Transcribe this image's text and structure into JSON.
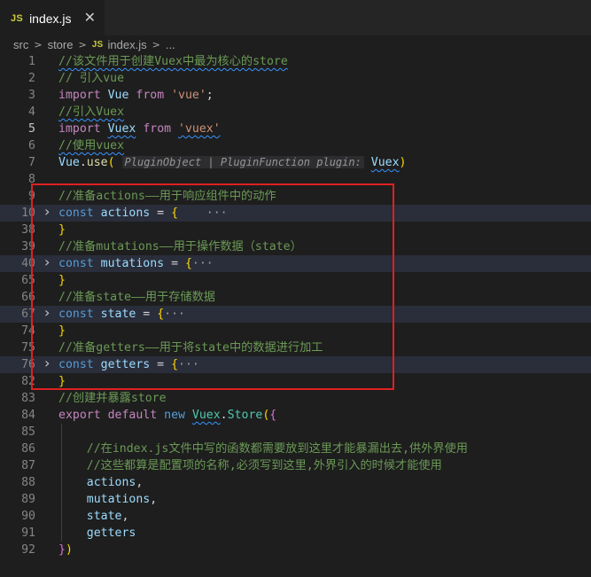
{
  "tab": {
    "badge": "JS",
    "filename": "index.js",
    "close": "✕"
  },
  "breadcrumb": {
    "items": [
      "src",
      "store",
      "index.js",
      "..."
    ],
    "badge": "JS"
  },
  "lines": [
    {
      "n": "1",
      "tokens": [
        [
          "c-comment",
          "//该文件用于创建Vuex中最为核心的store"
        ]
      ]
    },
    {
      "n": "2",
      "tokens": [
        [
          "c-comment",
          "// 引入vue"
        ]
      ]
    },
    {
      "n": "3",
      "tokens": [
        [
          "c-imp",
          "import"
        ],
        [
          "",
          " "
        ],
        [
          "c-var",
          "Vue"
        ],
        [
          "",
          " "
        ],
        [
          "c-imp",
          "from"
        ],
        [
          "",
          " "
        ],
        [
          "c-str",
          "'vue'"
        ],
        [
          "",
          ";"
        ]
      ]
    },
    {
      "n": "4",
      "tokens": [
        [
          "c-comment",
          "//引入Vuex"
        ]
      ]
    },
    {
      "n": "5",
      "active": true,
      "tokens": [
        [
          "c-imp",
          "import"
        ],
        [
          "",
          " "
        ],
        [
          "c-var",
          "Vuex"
        ],
        [
          "",
          " "
        ],
        [
          "c-imp",
          "from"
        ],
        [
          "",
          " "
        ],
        [
          "c-str",
          "'vuex'"
        ]
      ]
    },
    {
      "n": "6",
      "tokens": [
        [
          "c-comment",
          "//使用vuex"
        ]
      ]
    },
    {
      "n": "7",
      "tokens": [
        [
          "c-var",
          "Vue"
        ],
        [
          "",
          "."
        ],
        [
          "c-fn",
          "use"
        ],
        [
          "c-brace",
          "("
        ],
        [
          "",
          " "
        ],
        [
          "c-hint",
          "PluginObject | PluginFunction plugin:"
        ],
        [
          "",
          " "
        ],
        [
          "c-var",
          "Vuex"
        ],
        [
          "c-brace",
          ")"
        ]
      ]
    },
    {
      "n": "8",
      "tokens": []
    },
    {
      "n": "9",
      "tokens": [
        [
          "c-comment",
          "//准备actions——用于响应组件中的动作"
        ]
      ]
    },
    {
      "n": "10",
      "fold": true,
      "tokens": [
        [
          "c-kw",
          "const"
        ],
        [
          "",
          " "
        ],
        [
          "c-var",
          "actions"
        ],
        [
          "",
          " = "
        ],
        [
          "c-brace",
          "{"
        ],
        [
          "",
          "    "
        ],
        [
          "c-ellipsis",
          "···"
        ]
      ]
    },
    {
      "n": "38",
      "tokens": [
        [
          "c-brace",
          "}"
        ]
      ]
    },
    {
      "n": "39",
      "tokens": [
        [
          "c-comment",
          "//准备mutations——用于操作数据（state）"
        ]
      ]
    },
    {
      "n": "40",
      "fold": true,
      "tokens": [
        [
          "c-kw",
          "const"
        ],
        [
          "",
          " "
        ],
        [
          "c-var",
          "mutations"
        ],
        [
          "",
          " = "
        ],
        [
          "c-brace",
          "{"
        ],
        [
          "c-ellipsis",
          "···"
        ]
      ]
    },
    {
      "n": "65",
      "tokens": [
        [
          "c-brace",
          "}"
        ]
      ]
    },
    {
      "n": "66",
      "tokens": [
        [
          "c-comment",
          "//准备state——用于存储数据"
        ]
      ]
    },
    {
      "n": "67",
      "fold": true,
      "tokens": [
        [
          "c-kw",
          "const"
        ],
        [
          "",
          " "
        ],
        [
          "c-var",
          "state"
        ],
        [
          "",
          " = "
        ],
        [
          "c-brace",
          "{"
        ],
        [
          "c-ellipsis",
          "···"
        ]
      ]
    },
    {
      "n": "74",
      "tokens": [
        [
          "c-brace",
          "}"
        ]
      ]
    },
    {
      "n": "75",
      "tokens": [
        [
          "c-comment",
          "//准备getters——用于将state中的数据进行加工"
        ]
      ]
    },
    {
      "n": "76",
      "fold": true,
      "tokens": [
        [
          "c-kw",
          "const"
        ],
        [
          "",
          " "
        ],
        [
          "c-var",
          "getters"
        ],
        [
          "",
          " = "
        ],
        [
          "c-brace",
          "{"
        ],
        [
          "c-ellipsis",
          "···"
        ]
      ]
    },
    {
      "n": "82",
      "tokens": [
        [
          "c-brace",
          "}"
        ]
      ]
    },
    {
      "n": "83",
      "tokens": [
        [
          "c-comment",
          "//创建并暴露store"
        ]
      ]
    },
    {
      "n": "84",
      "tokens": [
        [
          "c-imp",
          "export"
        ],
        [
          "",
          " "
        ],
        [
          "c-imp",
          "default"
        ],
        [
          "",
          " "
        ],
        [
          "c-kw",
          "new"
        ],
        [
          "",
          " "
        ],
        [
          "c-cls",
          "Vuex"
        ],
        [
          "",
          "."
        ],
        [
          "c-cls",
          "Store"
        ],
        [
          "c-brace",
          "("
        ],
        [
          "c-paren",
          "{"
        ]
      ]
    },
    {
      "n": "85",
      "guide": true,
      "tokens": []
    },
    {
      "n": "86",
      "guide": true,
      "tokens": [
        [
          "",
          "    "
        ],
        [
          "c-comment",
          "//在index.js文件中写的函数都需要放到这里才能暴漏出去,供外界使用"
        ]
      ]
    },
    {
      "n": "87",
      "guide": true,
      "tokens": [
        [
          "",
          "    "
        ],
        [
          "c-comment",
          "//这些都算是配置项的名称,必须写到这里,外界引入的时候才能使用"
        ]
      ]
    },
    {
      "n": "88",
      "guide": true,
      "tokens": [
        [
          "",
          "    "
        ],
        [
          "c-var",
          "actions"
        ],
        [
          "",
          ","
        ]
      ]
    },
    {
      "n": "89",
      "guide": true,
      "tokens": [
        [
          "",
          "    "
        ],
        [
          "c-var",
          "mutations"
        ],
        [
          "",
          ","
        ]
      ]
    },
    {
      "n": "90",
      "guide": true,
      "tokens": [
        [
          "",
          "    "
        ],
        [
          "c-var",
          "state"
        ],
        [
          "",
          ","
        ]
      ]
    },
    {
      "n": "91",
      "guide": true,
      "tokens": [
        [
          "",
          "    "
        ],
        [
          "c-var",
          "getters"
        ]
      ]
    },
    {
      "n": "92",
      "tokens": [
        [
          "c-paren",
          "}"
        ],
        [
          "c-brace",
          ")"
        ]
      ]
    }
  ]
}
